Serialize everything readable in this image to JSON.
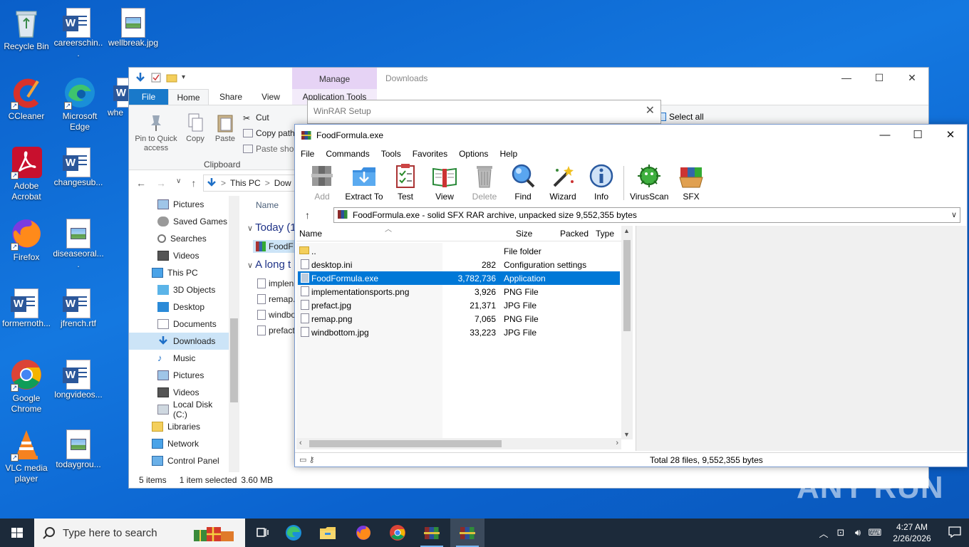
{
  "desktop": {
    "icons": [
      {
        "label": "Recycle Bin"
      },
      {
        "label": "careerschin..."
      },
      {
        "label": "wellbreak.jpg"
      },
      {
        "label": "CCleaner"
      },
      {
        "label": "Microsoft Edge"
      },
      {
        "label": "whe"
      },
      {
        "label": "Adobe Acrobat"
      },
      {
        "label": "changesub..."
      },
      {
        "label": "Firefox"
      },
      {
        "label": "diseaseoral...."
      },
      {
        "label": "formernoth..."
      },
      {
        "label": "jfrench.rtf"
      },
      {
        "label": "Google Chrome"
      },
      {
        "label": "longvideos..."
      },
      {
        "label": "VLC media player"
      },
      {
        "label": "todaygrou..."
      }
    ]
  },
  "explorer": {
    "title": "Downloads",
    "manage_tab": "Manage",
    "tabs": {
      "file": "File",
      "home": "Home",
      "share": "Share",
      "view": "View",
      "app_tools": "Application Tools"
    },
    "ribbon": {
      "pin": "Pin to Quick access",
      "copy": "Copy",
      "paste": "Paste",
      "cut": "Cut",
      "copy_path": "Copy path",
      "paste_shortcut": "Paste shor",
      "clipboard": "Clipboard",
      "select_all": "Select all"
    },
    "address": {
      "this_pc": "This PC",
      "sep": ">",
      "crumb": "Dow"
    },
    "nav": [
      {
        "label": "Pictures"
      },
      {
        "label": "Saved Games"
      },
      {
        "label": "Searches"
      },
      {
        "label": "Videos"
      },
      {
        "label": "This PC"
      },
      {
        "label": "3D Objects"
      },
      {
        "label": "Desktop"
      },
      {
        "label": "Documents"
      },
      {
        "label": "Downloads"
      },
      {
        "label": "Music"
      },
      {
        "label": "Pictures"
      },
      {
        "label": "Videos"
      },
      {
        "label": "Local Disk (C:)"
      },
      {
        "label": "Libraries"
      },
      {
        "label": "Network"
      },
      {
        "label": "Control Panel"
      }
    ],
    "files": {
      "name_header": "Name",
      "group_today": "Today (1",
      "group_long": "A long t",
      "today_item": "FoodF",
      "items": [
        "implen",
        "remap.",
        "windbo",
        "prefact"
      ]
    },
    "status": {
      "count": "5 items",
      "selected": "1 item selected",
      "size": "3.60 MB"
    }
  },
  "winrar_setup": {
    "title": "WinRAR Setup"
  },
  "winrar": {
    "title": "FoodFormula.exe",
    "menu": [
      "File",
      "Commands",
      "Tools",
      "Favorites",
      "Options",
      "Help"
    ],
    "toolbar": [
      {
        "label": "Add",
        "icon": "add-archive-icon"
      },
      {
        "label": "Extract To",
        "icon": "extract-to-icon"
      },
      {
        "label": "Test",
        "icon": "test-icon"
      },
      {
        "label": "View",
        "icon": "view-icon"
      },
      {
        "label": "Delete",
        "icon": "delete-icon"
      },
      {
        "label": "Find",
        "icon": "find-icon"
      },
      {
        "label": "Wizard",
        "icon": "wizard-icon"
      },
      {
        "label": "Info",
        "icon": "info-icon"
      },
      {
        "label": "VirusScan",
        "icon": "virusscan-icon"
      },
      {
        "label": "SFX",
        "icon": "sfx-icon"
      }
    ],
    "path": "FoodFormula.exe - solid SFX RAR archive, unpacked size 9,552,355 bytes",
    "columns": {
      "name": "Name",
      "size": "Size",
      "packed": "Packed",
      "type": "Type"
    },
    "rows": [
      {
        "name": "..",
        "size": "",
        "type": "File folder",
        "folder": true
      },
      {
        "name": "desktop.ini",
        "size": "282",
        "type": "Configuration settings"
      },
      {
        "name": "FoodFormula.exe",
        "size": "3,782,736",
        "type": "Application",
        "selected": true
      },
      {
        "name": "implementationsports.png",
        "size": "3,926",
        "type": "PNG File"
      },
      {
        "name": "prefact.jpg",
        "size": "21,371",
        "type": "JPG File"
      },
      {
        "name": "remap.png",
        "size": "7,065",
        "type": "PNG File"
      },
      {
        "name": "windbottom.jpg",
        "size": "33,223",
        "type": "JPG File"
      }
    ],
    "status_total": "Total 28 files, 9,552,355 bytes"
  },
  "watermark": "ANY RUN",
  "taskbar": {
    "search_placeholder": "Type here to search",
    "time": "4:27 AM",
    "date": "2/26/2026"
  },
  "colors": {
    "selection": "#0078d7",
    "file_tab": "#1979ca",
    "taskbar": "#1c2a3a"
  }
}
